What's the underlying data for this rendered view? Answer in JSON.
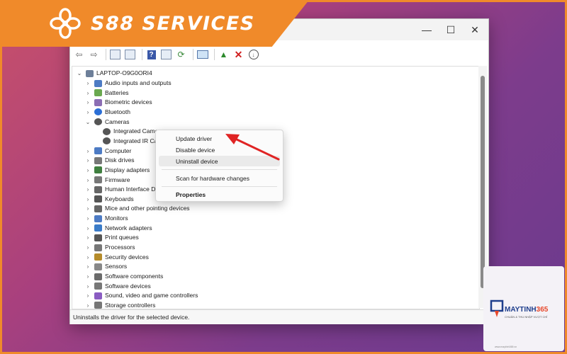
{
  "brand": {
    "name": "S88 SERVICES",
    "logo_icon": "quatrefoil-logo-icon",
    "color": "#f08a2a"
  },
  "window": {
    "controls": {
      "minimize": "—",
      "maximize": "☐",
      "close": "✕"
    },
    "toolbar_icons": [
      "back-arrow-icon",
      "forward-arrow-icon",
      "properties-icon",
      "show-hidden-icon",
      "help-icon",
      "details-icon",
      "refresh-icon",
      "monitor-icon",
      "update-driver-icon",
      "uninstall-icon",
      "download-icon"
    ],
    "status": "Uninstalls the driver for the selected device."
  },
  "tree": {
    "root": "LAPTOP-O9G0ORI4",
    "categories": [
      {
        "label": "Audio inputs and outputs",
        "expanded": false,
        "icon": "speaker-icon"
      },
      {
        "label": "Batteries",
        "expanded": false,
        "icon": "battery-icon"
      },
      {
        "label": "Biometric devices",
        "expanded": false,
        "icon": "fingerprint-icon"
      },
      {
        "label": "Bluetooth",
        "expanded": false,
        "icon": "bluetooth-icon"
      },
      {
        "label": "Cameras",
        "expanded": true,
        "icon": "camera-icon"
      },
      {
        "label": "Integrated Camera",
        "child": true,
        "icon": "webcam-icon"
      },
      {
        "label": "Integrated IR Camera",
        "child": true,
        "icon": "webcam-icon"
      },
      {
        "label": "Computer",
        "expanded": false,
        "icon": "computer-icon"
      },
      {
        "label": "Disk drives",
        "expanded": false,
        "icon": "disk-icon"
      },
      {
        "label": "Display adapters",
        "expanded": false,
        "icon": "display-adapter-icon"
      },
      {
        "label": "Firmware",
        "expanded": false,
        "icon": "firmware-icon"
      },
      {
        "label": "Human Interface Devices",
        "expanded": false,
        "icon": "hid-icon"
      },
      {
        "label": "Keyboards",
        "expanded": false,
        "icon": "keyboard-icon"
      },
      {
        "label": "Mice and other pointing devices",
        "expanded": false,
        "icon": "mouse-icon"
      },
      {
        "label": "Monitors",
        "expanded": false,
        "icon": "monitor-icon"
      },
      {
        "label": "Network adapters",
        "expanded": false,
        "icon": "network-icon"
      },
      {
        "label": "Print queues",
        "expanded": false,
        "icon": "printer-icon"
      },
      {
        "label": "Processors",
        "expanded": false,
        "icon": "processor-icon"
      },
      {
        "label": "Security devices",
        "expanded": false,
        "icon": "security-icon"
      },
      {
        "label": "Sensors",
        "expanded": false,
        "icon": "sensor-icon"
      },
      {
        "label": "Software components",
        "expanded": false,
        "icon": "software-component-icon"
      },
      {
        "label": "Software devices",
        "expanded": false,
        "icon": "software-device-icon"
      },
      {
        "label": "Sound, video and game controllers",
        "expanded": false,
        "icon": "sound-icon"
      },
      {
        "label": "Storage controllers",
        "expanded": false,
        "icon": "storage-icon"
      }
    ]
  },
  "context_menu": {
    "items": [
      {
        "label": "Update driver"
      },
      {
        "label": "Disable device"
      },
      {
        "label": "Uninstall device",
        "highlighted": true
      },
      {
        "label": "Scan for hardware changes"
      },
      {
        "label": "Properties",
        "bold": true
      }
    ]
  },
  "watermark": {
    "title_a": "MAYTINH",
    "title_b": "365",
    "subtitle": "CHUẨN & THU NHẬP VƯỢT CHỈ",
    "footer": "www.maytinh365.vn"
  },
  "colors": {
    "accent_orange": "#f08a2a",
    "arrow_red": "#e02424",
    "brand_blue": "#1e3e8c"
  }
}
